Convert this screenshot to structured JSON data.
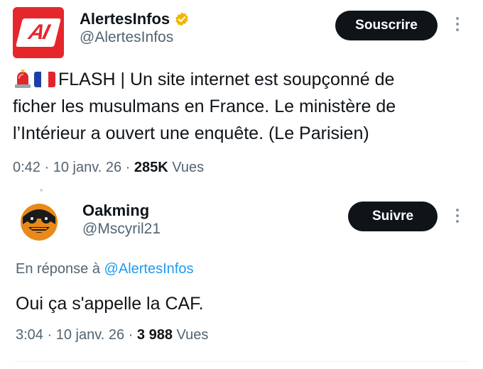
{
  "main_tweet": {
    "author_name": "AlertesInfos",
    "author_handle": "@AlertesInfos",
    "logo_text": "AI",
    "follow_button": "Souscrire",
    "text_line1": "FLASH | Un site internet est soupçonné de",
    "text_line2": "ficher les musulmans en France. Le ministère de",
    "text_line3": "l’Intérieur a ouvert une enquête. (Le Parisien)",
    "emojis": [
      "police-light",
      "flag-france"
    ],
    "time": "0:42",
    "date": "10 janv. 26",
    "views_count": "285K",
    "views_label": "Vues",
    "separator": "·"
  },
  "reply": {
    "author_name": "Oakming",
    "author_handle": "@Mscyril21",
    "follow_button": "Suivre",
    "reply_prefix": "En réponse à",
    "reply_mention": "@AlertesInfos",
    "text": "Oui ça s'appelle la CAF.",
    "time": "3:04",
    "date": "10 janv. 26",
    "views_count": "3 988",
    "views_label": "Vues",
    "separator": "·"
  },
  "colors": {
    "accent": "#1d9bf0",
    "brand_red": "#e5262b",
    "verified_gold": "#f2b705",
    "text_primary": "#0f1419",
    "text_secondary": "#536471"
  }
}
